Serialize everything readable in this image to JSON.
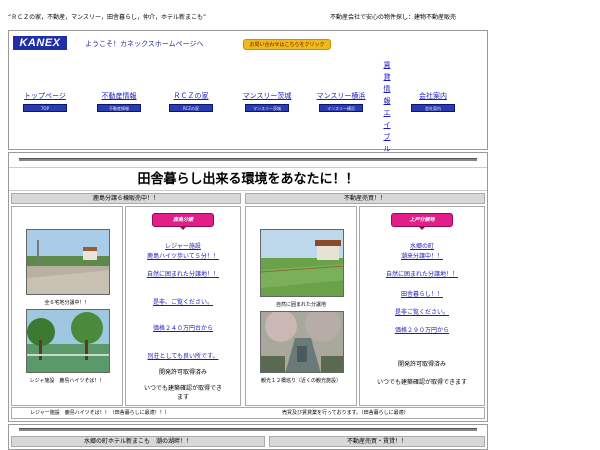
{
  "top_bar": {
    "left_text": "“ＲＣＺの家，不動産，マンスリー，田舎暮らし，仲介，ホテル新まこも”",
    "right_text": "不動産会社で安心の物件探し：建物不動産販売"
  },
  "header": {
    "logo": "KANEX",
    "welcome": "ようこそ！カネックスホームページへ",
    "inquiry_button": "お問い合わせはこちらをクリック"
  },
  "nav": {
    "items": [
      {
        "label": "トップページ",
        "button": "TOP"
      },
      {
        "label": "不動産情報",
        "button": "不動産情報"
      },
      {
        "label": "ＲＣＺの家",
        "button": "RCZの家"
      },
      {
        "label": "マンスリー茨城",
        "button": "マンスリー茨城"
      },
      {
        "label": "マンスリー横浜",
        "button": "マンスリー横浜"
      }
    ],
    "vertical_link": "賃貸情報エイブル",
    "company": {
      "label": "会社案内",
      "button": "会社案内"
    }
  },
  "main": {
    "headline": "田舎暮らし出来る環境をあなたに！！",
    "left_section_title": "鹿島分譲６棟販売中！！",
    "right_section_title": "不動産売買！！",
    "col_a": {
      "caption1": "全６宅地分譲中！！",
      "caption2": "レジャ施設　鹿島ハイツそば！！"
    },
    "col_b": {
      "badge": "鹿島分譲",
      "lines": [
        {
          "text": "レジャー施設",
          "link": true
        },
        {
          "text": "鹿島ハイツ歩いて５分！！",
          "link": true
        },
        {
          "text": "自然に囲まれた分譲地！！",
          "link": true
        },
        {
          "text": "是非、ご覧ください。",
          "link": true
        },
        {
          "text": "価格２４０万円台から",
          "link": true
        },
        {
          "text": "別荘としても良い所です。",
          "link": true
        },
        {
          "text": "開発許可取得済み",
          "link": false
        },
        {
          "text": "いつでも建築確認が取得でき",
          "link": false
        },
        {
          "text": "ます",
          "link": false
        }
      ]
    },
    "col_c": {
      "caption1": "自然に囲まれた分譲地",
      "caption2": "観光１２橋巡り（近くの観光施設）"
    },
    "col_d": {
      "badge": "上戸分譲地",
      "lines": [
        {
          "text": "水郷の町",
          "link": true
        },
        {
          "text": "潮来分譲中！！",
          "link": true
        },
        {
          "text": "自然に囲まれた分譲地！！",
          "link": true
        },
        {
          "text": "田舎暮らし！！",
          "link": true
        },
        {
          "text": "是非ご覧ください。",
          "link": true
        },
        {
          "text": "価格２９０万円から",
          "link": true
        },
        {
          "text": "開発許可取得済み",
          "link": false
        },
        {
          "text": "いつでも建築確認が取得できます",
          "link": false
        }
      ]
    },
    "footer_left": "レジャー施設　鹿島ハイツそば！！（田舎暮らしに最適！！）",
    "footer_right": "売買及び賃貸業を行っております。（田舎暮らしに最適）"
  },
  "bottom": {
    "left_title": "水郷の町ホテル新まこも　潮の湖畔！！",
    "right_title": "不動産売買・賃貸！！"
  },
  "colors": {
    "link": "#1a1ac0",
    "nav_button": "#2a3ab0",
    "badge": "#e21e8a",
    "inquiry": "#f0b81a",
    "section_header": "#d8d8d8"
  }
}
